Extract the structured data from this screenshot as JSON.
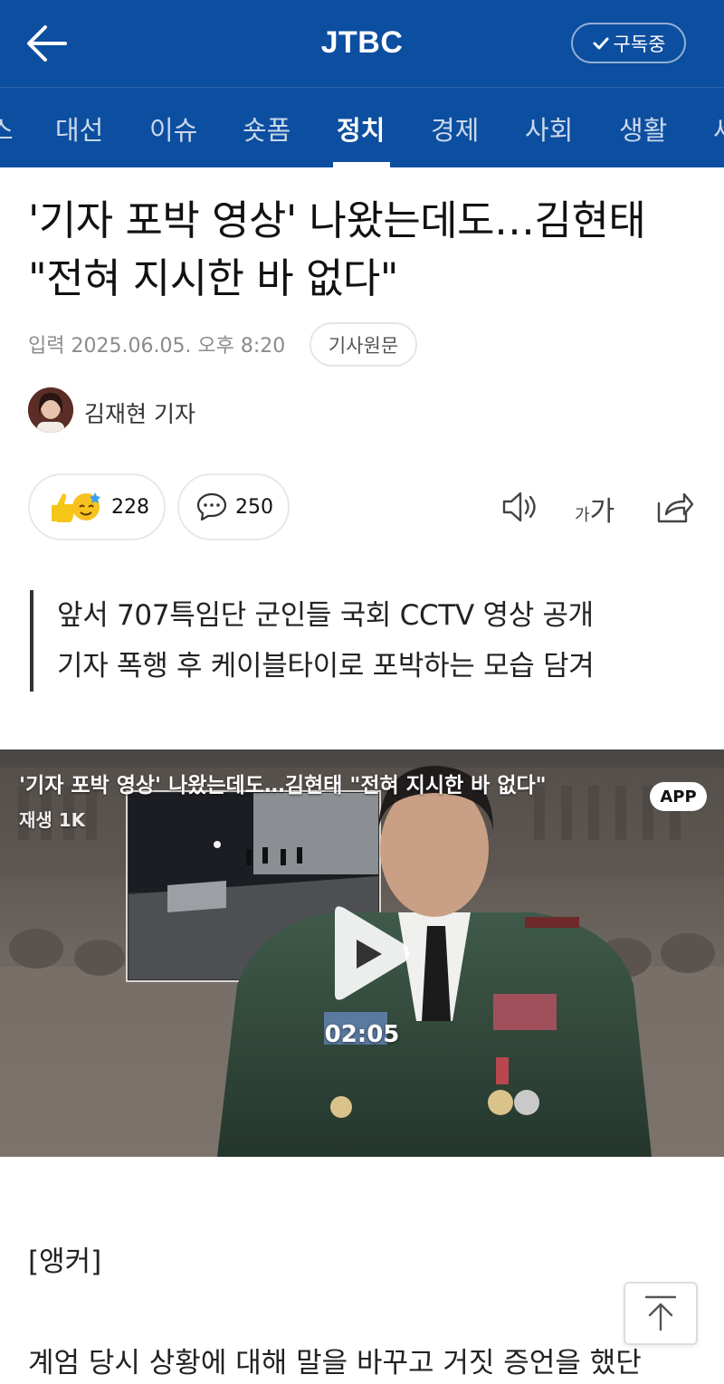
{
  "header": {
    "brand": "JTBC",
    "subscribe_label": "구독중"
  },
  "categories": [
    {
      "label": "스",
      "active": false
    },
    {
      "label": "대선",
      "active": false
    },
    {
      "label": "이슈",
      "active": false
    },
    {
      "label": "숏폼",
      "active": false
    },
    {
      "label": "정치",
      "active": true
    },
    {
      "label": "경제",
      "active": false
    },
    {
      "label": "사회",
      "active": false
    },
    {
      "label": "생활",
      "active": false
    },
    {
      "label": "세",
      "active": false
    }
  ],
  "article": {
    "headline": "'기자 포박 영상' 나왔는데도…김현태 \"전혀 지시한 바 없다\"",
    "published": "입력 2025.06.05. 오후 8:20",
    "original_label": "기사원문",
    "author": "김재현 기자",
    "reactions_count": "228",
    "comments_count": "250",
    "fontsize_small": "가",
    "fontsize_big": "가",
    "summary": [
      "앞서 707특임단 군인들 국회 CCTV 영상 공개",
      "기자 폭행 후 케이블타이로 포박하는 모습 담겨"
    ],
    "anchor_label": "[앵커]",
    "body_first_line": "계엄 당시 상황에 대해 말을 바꾸고 거짓 증언을 했단"
  },
  "video": {
    "title": "'기자 포박 영상' 나왔는데도…김현태 \"전혀 지시한 바 없다\"",
    "views": "재생 1K",
    "app_badge": "APP",
    "duration": "02:05"
  },
  "colors": {
    "brand_blue": "#0c4ea0"
  }
}
